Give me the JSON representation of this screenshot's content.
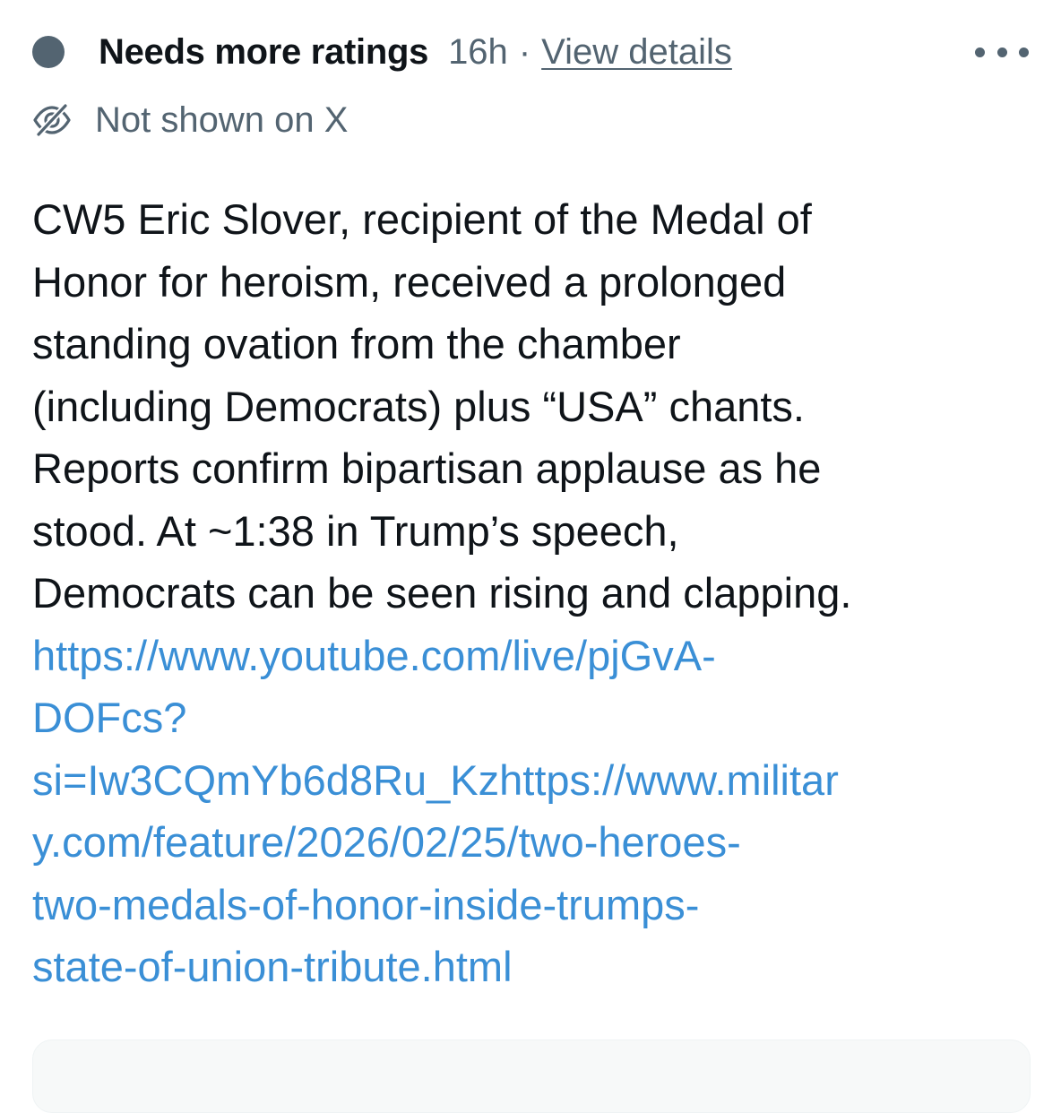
{
  "note_header": {
    "status_label": "Needs more ratings",
    "time": "16h",
    "separator": "·",
    "view_details_label": "View details",
    "more_icon": "ellipsis-icon",
    "status_dot_color": "#536471"
  },
  "visibility": {
    "icon": "eye-slash-icon",
    "label": "Not shown on X"
  },
  "note_body": {
    "text_lines": [
      "CW5 Eric Slover, recipient of the Medal of",
      "Honor for heroism, received a prolonged",
      "standing ovation from the chamber",
      "(including Democrats) plus “USA” chants.",
      "Reports confirm bipartisan applause as he",
      "stood. At ~1:38 in Trump’s speech,",
      "Democrats can be seen rising and clapping."
    ],
    "link_lines": [
      "https://www.youtube.com/live/pjGvA-",
      "DOFcs?",
      "si=Iw3CQmYb6d8Ru_Kzhttps://www.militar",
      "y.com/feature/2026/02/25/two-heroes-",
      "two-medals-of-honor-inside-trumps-",
      "state-of-union-tribute.html"
    ],
    "link_color": "#3a8fd6"
  }
}
